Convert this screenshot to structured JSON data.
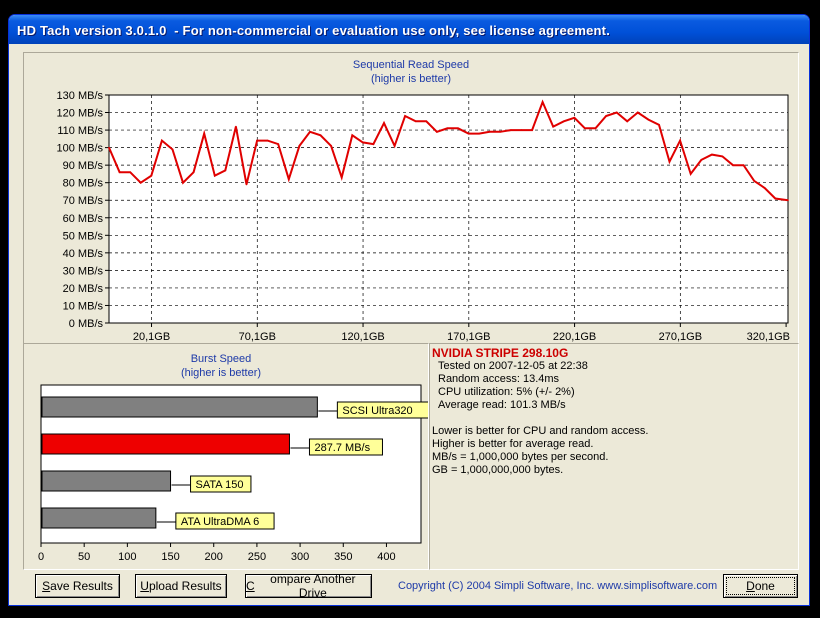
{
  "window": {
    "title": "HD Tach version 3.0.1.0  - For non-commercial or evaluation use only, see license agreement."
  },
  "seq_chart": {
    "title_line1": "Sequential Read Speed",
    "title_line2": "(higher is better)",
    "y_ticks": [
      "0 MB/s",
      "10 MB/s",
      "20 MB/s",
      "30 MB/s",
      "40 MB/s",
      "50 MB/s",
      "60 MB/s",
      "70 MB/s",
      "80 MB/s",
      "90 MB/s",
      "100 MB/s",
      "110 MB/s",
      "120 MB/s",
      "130 MB/s"
    ],
    "x_ticks": [
      "20,1GB",
      "70,1GB",
      "120,1GB",
      "170,1GB",
      "220,1GB",
      "270,1GB",
      "320,1GB"
    ],
    "line_color": "#e00000"
  },
  "burst_chart": {
    "title_line1": "Burst Speed",
    "title_line2": "(higher is better)",
    "x_ticks": [
      "0",
      "50",
      "100",
      "150",
      "200",
      "250",
      "300",
      "350",
      "400"
    ],
    "bars": [
      {
        "label": "SCSI Ultra320",
        "color": "#808080"
      },
      {
        "label": "287.7 MB/s",
        "color": "#ee0000"
      },
      {
        "label": "SATA 150",
        "color": "#808080"
      },
      {
        "label": "ATA UltraDMA 6",
        "color": "#808080"
      }
    ]
  },
  "chart_data": [
    {
      "type": "line",
      "title": "Sequential Read Speed",
      "subtitle": "(higher is better)",
      "xlabel": "",
      "ylabel": "",
      "x_range_gb": [
        0,
        321
      ],
      "ylim": [
        0,
        130
      ],
      "y_unit": "MB/s",
      "grid": true,
      "x": [
        0,
        5,
        10,
        15,
        20,
        25,
        30,
        35,
        40,
        45,
        50,
        55,
        60,
        65,
        70,
        75,
        80,
        85,
        90,
        95,
        100,
        105,
        110,
        115,
        120,
        125,
        130,
        135,
        140,
        145,
        150,
        155,
        160,
        165,
        170,
        175,
        180,
        185,
        190,
        195,
        200,
        205,
        210,
        215,
        220,
        225,
        230,
        235,
        240,
        245,
        250,
        255,
        260,
        265,
        270,
        275,
        280,
        285,
        290,
        295,
        300,
        305,
        310,
        315,
        321
      ],
      "y": [
        100,
        86,
        86,
        80,
        84,
        104,
        99,
        80,
        86,
        108,
        84,
        87,
        112,
        79,
        104,
        104,
        102,
        82,
        101,
        109,
        107,
        101,
        83,
        107,
        103,
        102,
        114,
        101,
        118,
        115,
        115,
        109,
        111,
        111,
        108,
        108,
        109,
        109,
        110,
        110,
        110,
        126,
        112,
        115,
        117,
        111,
        111,
        118,
        120,
        115,
        120,
        116,
        113,
        92,
        104,
        85,
        93,
        96,
        95,
        90,
        90,
        81,
        77,
        71,
        70
      ]
    },
    {
      "type": "bar",
      "title": "Burst Speed",
      "subtitle": "(higher is better)",
      "orientation": "horizontal",
      "categories": [
        "SCSI Ultra320",
        "287.7 MB/s",
        "SATA 150",
        "ATA UltraDMA 6"
      ],
      "values": [
        320,
        287.7,
        150,
        133
      ],
      "xlim": [
        0,
        440
      ]
    }
  ],
  "info": {
    "drive_name": "NVIDIA STRIPE 298.10G",
    "tested_on": "Tested on 2007-12-05 at 22:38",
    "random_access": "Random access: 13.4ms",
    "cpu_utilization": "CPU utilization: 5% (+/- 2%)",
    "average_read": "Average read: 101.3 MB/s",
    "note1": "Lower is better for CPU and random access.",
    "note2": "Higher is better for average read.",
    "note3": "MB/s = 1,000,000 bytes per second.",
    "note4": "GB = 1,000,000,000 bytes."
  },
  "buttons": {
    "save": {
      "first": "S",
      "rest": "ave Results"
    },
    "upload": {
      "first": "U",
      "rest": "pload Results"
    },
    "compare": {
      "first": "C",
      "rest": "ompare Another Drive"
    },
    "done": {
      "first": "D",
      "rest": "one"
    }
  },
  "copyright": "Copyright (C) 2004 Simpli Software, Inc. www.simplisoftware.com"
}
